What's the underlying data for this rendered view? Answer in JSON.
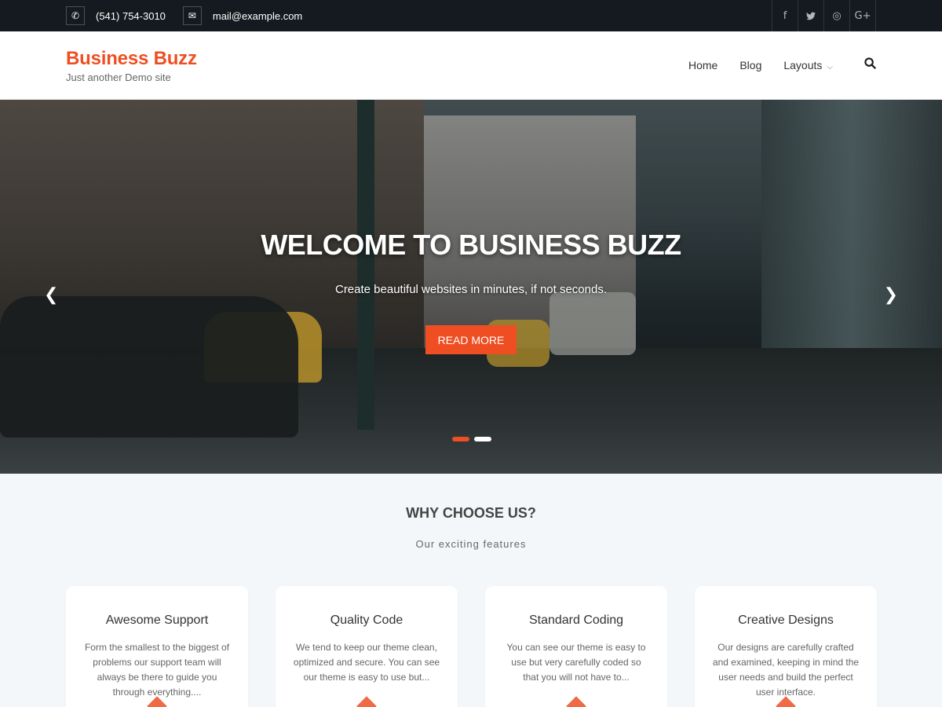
{
  "topbar": {
    "phone": "(541) 754-3010",
    "email": "mail@example.com",
    "phone_icon": "phone-icon",
    "email_icon": "envelope-icon",
    "social": [
      {
        "name": "facebook-icon",
        "glyph": "f"
      },
      {
        "name": "twitter-icon",
        "glyph": "🐦"
      },
      {
        "name": "instagram-icon",
        "glyph": "◎"
      },
      {
        "name": "google-plus-icon",
        "glyph": "G+"
      }
    ]
  },
  "header": {
    "site_title": "Business Buzz",
    "tagline": "Just another Demo site",
    "nav": {
      "home": "Home",
      "blog": "Blog",
      "layouts": "Layouts"
    }
  },
  "hero": {
    "title": "WELCOME TO BUSINESS BUZZ",
    "subtitle": "Create beautiful websites in minutes, if not seconds.",
    "button": "READ MORE"
  },
  "features": {
    "title": "WHY CHOOSE US?",
    "subtitle": "Our exciting features",
    "cards": [
      {
        "title": "Awesome Support",
        "text": "Form the smallest to the biggest of problems our support team will always be there to guide you through everything...."
      },
      {
        "title": "Quality Code",
        "text": "We tend to keep our theme clean, optimized and secure. You can see our theme is easy to use but..."
      },
      {
        "title": "Standard Coding",
        "text": "You can see our theme is easy to use but very carefully coded so that you will not have to..."
      },
      {
        "title": "Creative Designs",
        "text": "Our designs are carefully crafted and examined, keeping in mind the user needs and build the perfect user interface."
      }
    ]
  },
  "colors": {
    "accent": "#ef4e22",
    "topbar_bg": "#141a1f"
  }
}
